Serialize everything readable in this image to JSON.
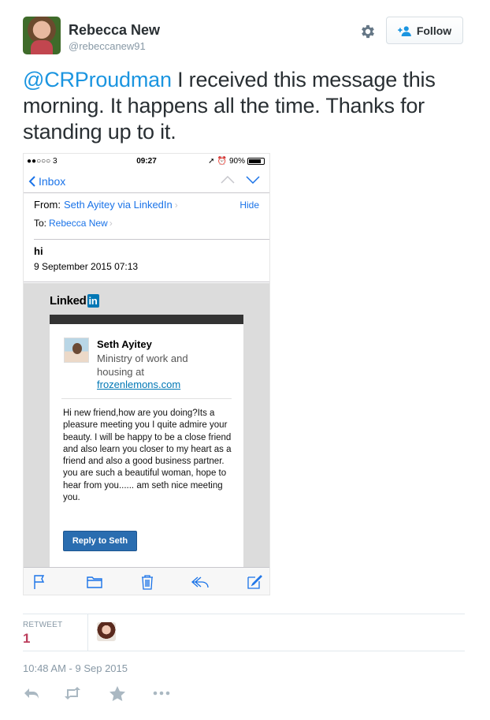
{
  "tweet": {
    "author_name": "Rebecca New",
    "author_handle": "@rebeccanew91",
    "follow_label": "Follow",
    "mention": "@CRProudman",
    "text": " I received this message this morning. It happens all the time. Thanks for standing up to it.",
    "timestamp": "10:48 AM - 9 Sep 2015"
  },
  "stats": {
    "retweet_label": "RETWEET",
    "retweet_count": "1"
  },
  "photo": {
    "status_bar": {
      "carrier": "●●○○○ 3",
      "time": "09:27",
      "battery": "90%"
    },
    "nav": {
      "back_label": "Inbox"
    },
    "email": {
      "from_label": "From:",
      "from_value": "Seth Ayitey via LinkedIn",
      "hide_label": "Hide",
      "to_label": "To:",
      "to_value": "Rebecca New",
      "subject": "hi",
      "date": "9 September 2015 07:13"
    },
    "linkedin": {
      "logo_text": "Linked",
      "logo_box": "in",
      "sender_name": "Seth Ayitey",
      "sender_title": "Ministry of work and housing at",
      "sender_link": "frozenlemons.com",
      "message": "Hi new friend,how are you doing?Its a pleasure meeting you I quite admire your beauty. I will be happy to be a close friend and also learn you closer to my heart as a friend and also a good business partner. you are such a beautiful woman, hope to hear from you...... am seth nice meeting you.",
      "reply_label": "Reply to Seth"
    }
  },
  "colors": {
    "mention": "#1b95e0",
    "ios_blue": "#1a73e8",
    "linkedin_blue": "#0077b5",
    "retweet_count": "#bc3e5c",
    "muted": "#8899a6"
  },
  "icons": {
    "settings": "gear-icon",
    "follow": "add-user-icon",
    "reply": "reply-icon",
    "retweet": "retweet-icon",
    "favorite": "star-icon",
    "more": "more-icon"
  }
}
